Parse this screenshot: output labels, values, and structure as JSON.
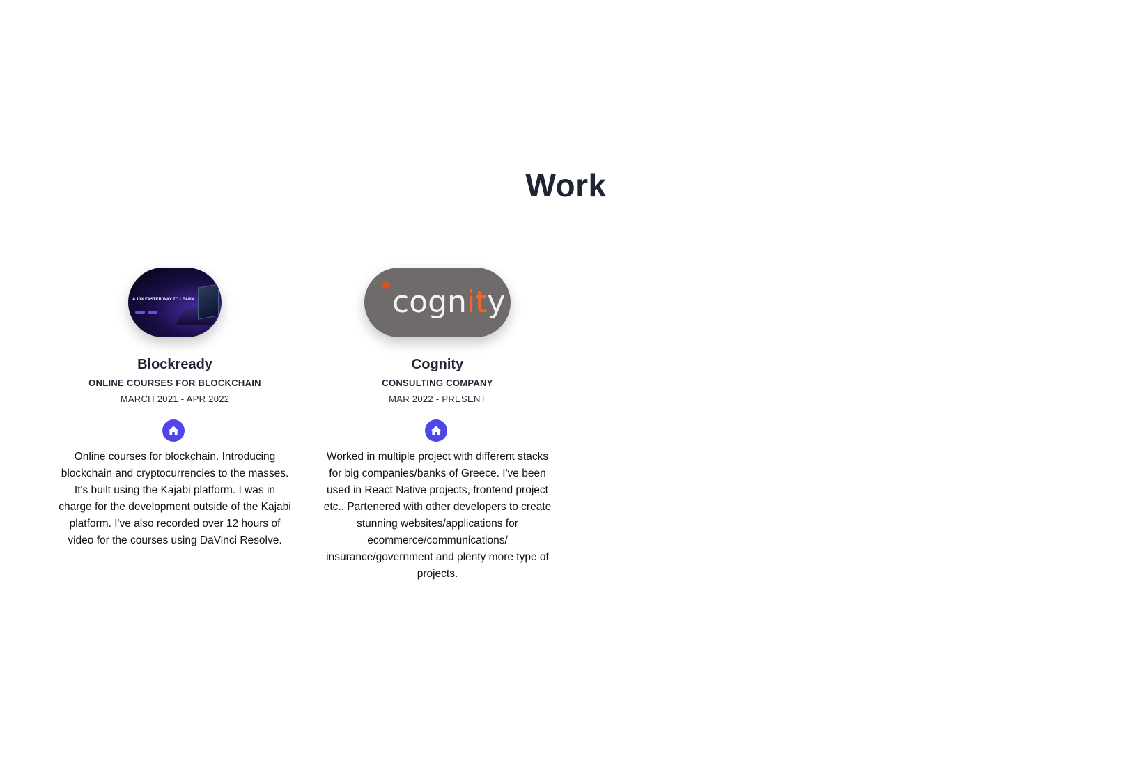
{
  "section": {
    "title": "Work"
  },
  "works": [
    {
      "name": "Blockready",
      "subtitle": "ONLINE COURSES FOR BLOCKCHAIN",
      "dates": "MARCH 2021 - APR 2022",
      "logo_headline": "A 10X FASTER WAY TO LEARN",
      "link_icon": "home-icon",
      "description": "Online courses for blockchain. Introducing blockchain and cryptocurrencies to the masses. It's built using the Kajabi platform. I was in charge for the development outside of the Kajabi platform. I've also recorded over 12 hours of video for the courses using DaVinci Resolve."
    },
    {
      "name": "Cognity",
      "subtitle": "CONSULTING COMPANY",
      "dates": "MAR 2022 - PRESENT",
      "logo_text_prefix": "cogn",
      "logo_text_accent": "it",
      "logo_text_suffix": "y",
      "logo_star": "*",
      "link_icon": "home-icon",
      "description": "Worked in multiple project with different stacks for big companies/banks of Greece. I've been used in React Native projects, frontend project etc.. Partenered with other developers to create stunning websites/applications for ecommerce/communications/ insurance/government and plenty more type of projects."
    }
  ],
  "colors": {
    "accent": "#4f46e5",
    "heading": "#1f2533",
    "cognity_bg": "#6f6b6b",
    "cognity_orange": "#f26522"
  }
}
